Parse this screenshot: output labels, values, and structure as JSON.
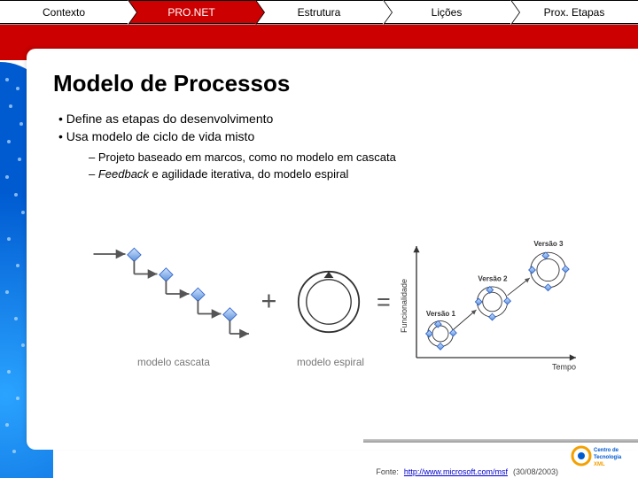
{
  "nav": {
    "items": [
      {
        "label": "Contexto"
      },
      {
        "label": "PRO.NET"
      },
      {
        "label": "Estrutura"
      },
      {
        "label": "Lições"
      },
      {
        "label": "Prox. Etapas"
      }
    ],
    "activeIndex": 1
  },
  "title": "Modelo de Processos",
  "bullets": [
    "Define as etapas do desenvolvimento",
    "Usa modelo de ciclo de vida misto"
  ],
  "subbullets": [
    {
      "plain_pre": "Projeto baseado em marcos, como no modelo em cascata"
    },
    {
      "italic": "Feedback",
      "plain_post": " e agilidade iterativa, do modelo espiral"
    }
  ],
  "diagram": {
    "cascade_label": "modelo cascata",
    "spiral_label": "modelo espiral",
    "plus": "+",
    "equals": "=",
    "y_axis": "Funcionalidade",
    "x_axis": "Tempo",
    "versions": [
      "Versão 1",
      "Versão 2",
      "Versão 3"
    ]
  },
  "footer": {
    "prefix": "Fonte: ",
    "link": "http://www.microsoft.com/msf",
    "suffix": " (30/08/2003)"
  },
  "logo": {
    "line1": "Centro de",
    "line2": "Tecnologia",
    "line3": "XML"
  }
}
